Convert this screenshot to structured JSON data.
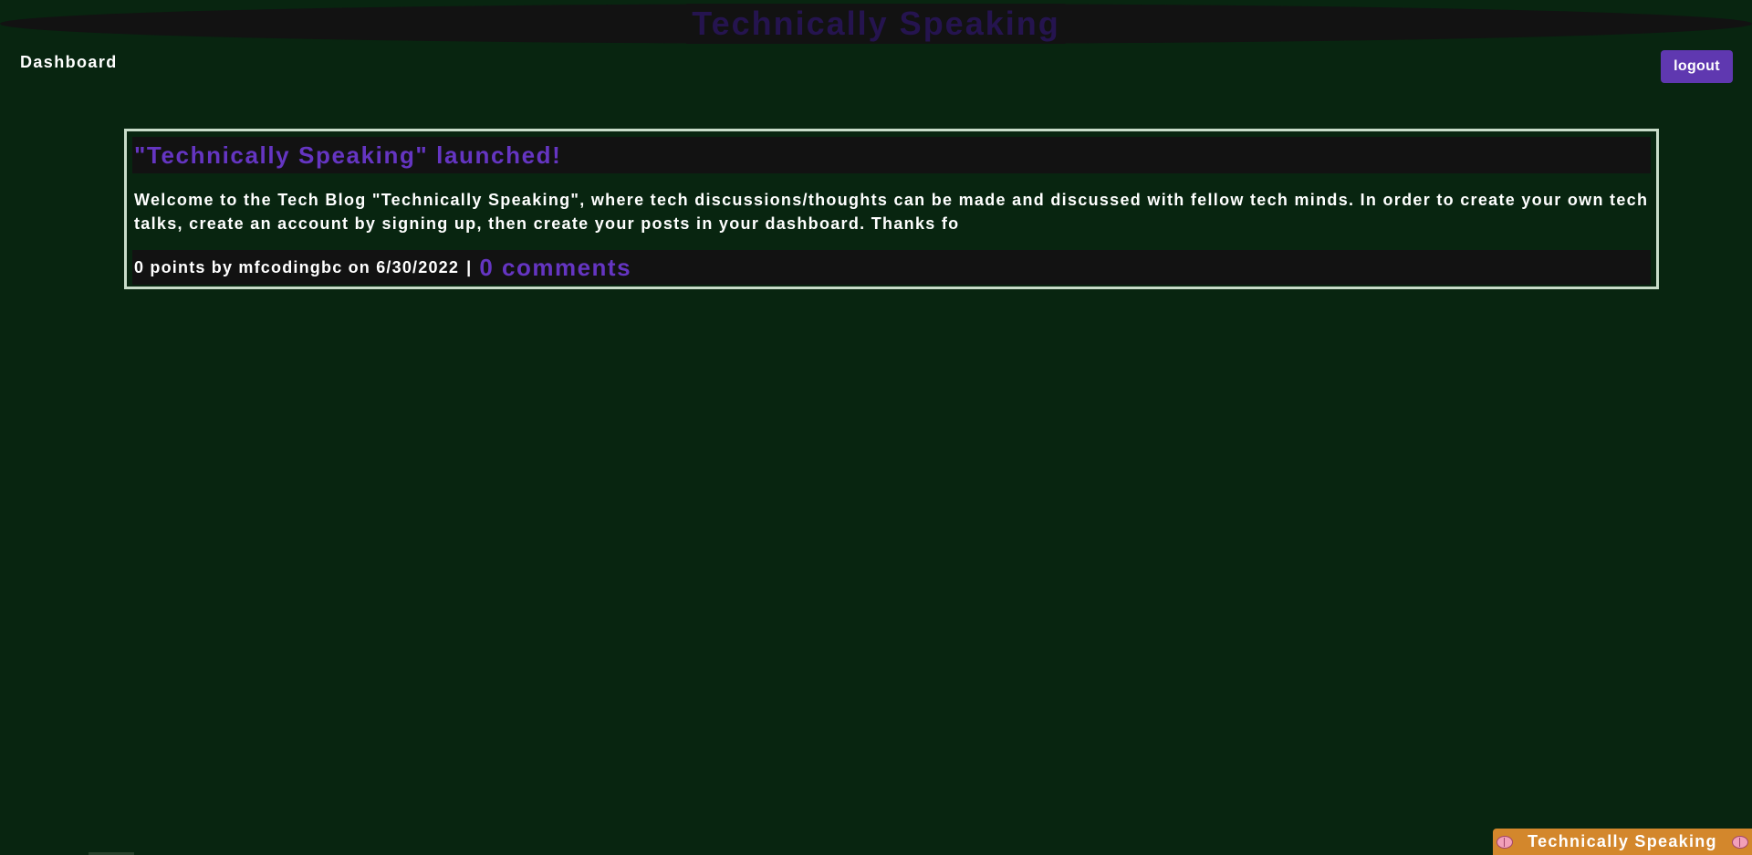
{
  "header": {
    "site_title": "Technically Speaking"
  },
  "nav": {
    "dashboard_label": "Dashboard",
    "logout_label": "logout"
  },
  "posts": [
    {
      "title": "\"Technically Speaking\" launched!",
      "body": "Welcome to the Tech Blog \"Technically Speaking\", where tech discussions/thoughts can be made and discussed with fellow tech minds. In order to create your own tech talks, create an account by signing up, then create your posts in your dashboard. Thanks fo",
      "meta": "0 points by mfcodingbc on 6/30/2022",
      "separator": "|",
      "comments_label": "0 comments"
    }
  ],
  "footer": {
    "badge_text": "Technically Speaking",
    "icon_left": "brain-icon",
    "icon_right": "brain-icon"
  },
  "colors": {
    "background": "#082510",
    "header_bar": "#121212",
    "title_text": "#25144f",
    "accent_purple": "#6535c2",
    "button_purple": "#5f38b0",
    "card_border": "#c8dcc9",
    "footer_badge": "#d3872c"
  }
}
